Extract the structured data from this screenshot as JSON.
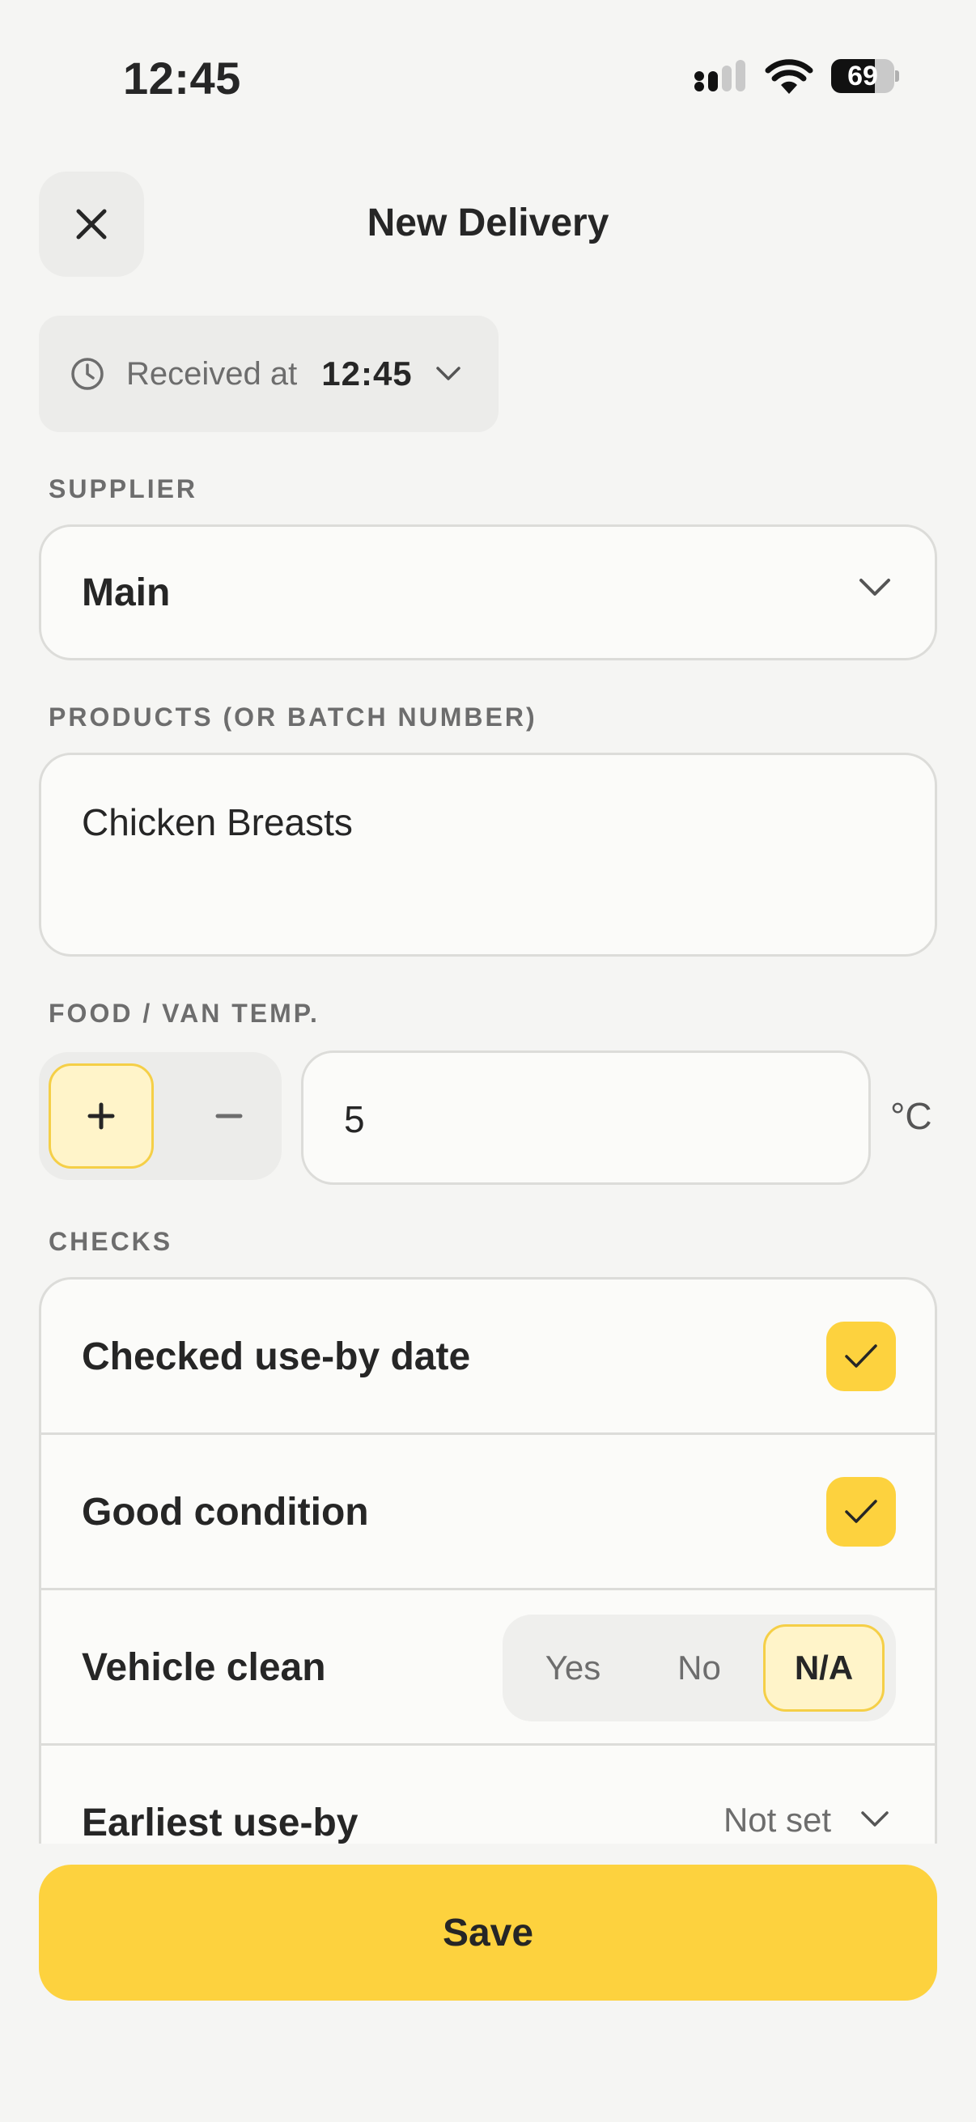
{
  "status": {
    "time": "12:45",
    "battery_level": "69",
    "signal_icon": "cellular-signal-icon",
    "wifi_icon": "wifi-icon"
  },
  "header": {
    "title": "New Delivery",
    "close_icon": "close-icon"
  },
  "received": {
    "label": "Received at",
    "time": "12:45",
    "icon": "clock-icon"
  },
  "supplier": {
    "label": "SUPPLIER",
    "value": "Main"
  },
  "products": {
    "label": "PRODUCTS (OR BATCH NUMBER)",
    "value": "Chicken Breasts"
  },
  "temperature": {
    "label": "FOOD / VAN TEMP.",
    "plus": "+",
    "minus": "–",
    "value": "5",
    "unit": "°C"
  },
  "checks": {
    "label": "CHECKS",
    "items": [
      {
        "label": "Checked use-by date",
        "checked": true
      },
      {
        "label": "Good condition",
        "checked": true
      },
      {
        "label": "Vehicle clean",
        "options": [
          "Yes",
          "No",
          "N/A"
        ],
        "selected": "N/A"
      },
      {
        "label": "Earliest use-by",
        "value": "Not set"
      }
    ]
  },
  "footer": {
    "save_label": "Save"
  },
  "colors": {
    "accent": "#fdd23e",
    "accent_light": "#fff4c9",
    "background": "#f5f5f3",
    "text": "#262626",
    "muted": "#6d6d6d"
  }
}
